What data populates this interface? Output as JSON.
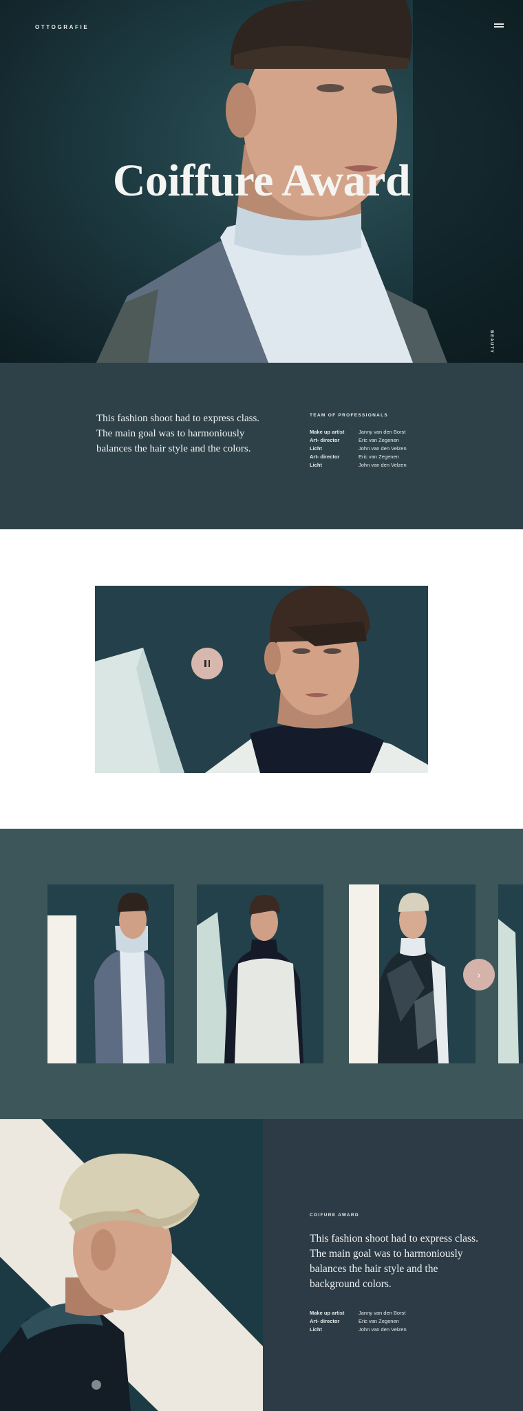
{
  "header": {
    "logo": "OTTOGRAFIE",
    "menu_icon": "hamburger-icon",
    "side_label": "BEAUTY"
  },
  "hero": {
    "title": "Coiffure Award"
  },
  "intro": {
    "text": "This fashion shoot had to express class. The main goal was to harmoniously balances the hair style and the colors.",
    "team_heading": "TEAM OF PROFESSIONALS",
    "team": [
      {
        "role": "Make up artist",
        "name": "Janny van den Borst"
      },
      {
        "role": "Art- director",
        "name": "Eric van Zegenen"
      },
      {
        "role": "Licht",
        "name": "John van den Velzen"
      },
      {
        "role": "Art- director",
        "name": "Eric van Zegenen"
      },
      {
        "role": "Licht",
        "name": "John van den Velzen"
      }
    ]
  },
  "video": {
    "pause_icon": "pause-icon"
  },
  "gallery": {
    "next_icon": "chevron-right-icon",
    "next_glyph": "›"
  },
  "feature": {
    "heading": "COIFURE AWARD",
    "text": "This fashion shoot had to express class. The main goal was to harmoniously balances the hair style and the background colors.",
    "team": [
      {
        "role": "Make up artist",
        "name": "Janny van den Borst"
      },
      {
        "role": "Art- director",
        "name": "Eric van Zegenen"
      },
      {
        "role": "Licht",
        "name": "John van den Velzen"
      }
    ]
  },
  "colors": {
    "accent": "#d6b4ac",
    "dark_teal": "#2e4148",
    "gallery_bg": "#3d5659",
    "feature_bg": "#2c3b46"
  }
}
